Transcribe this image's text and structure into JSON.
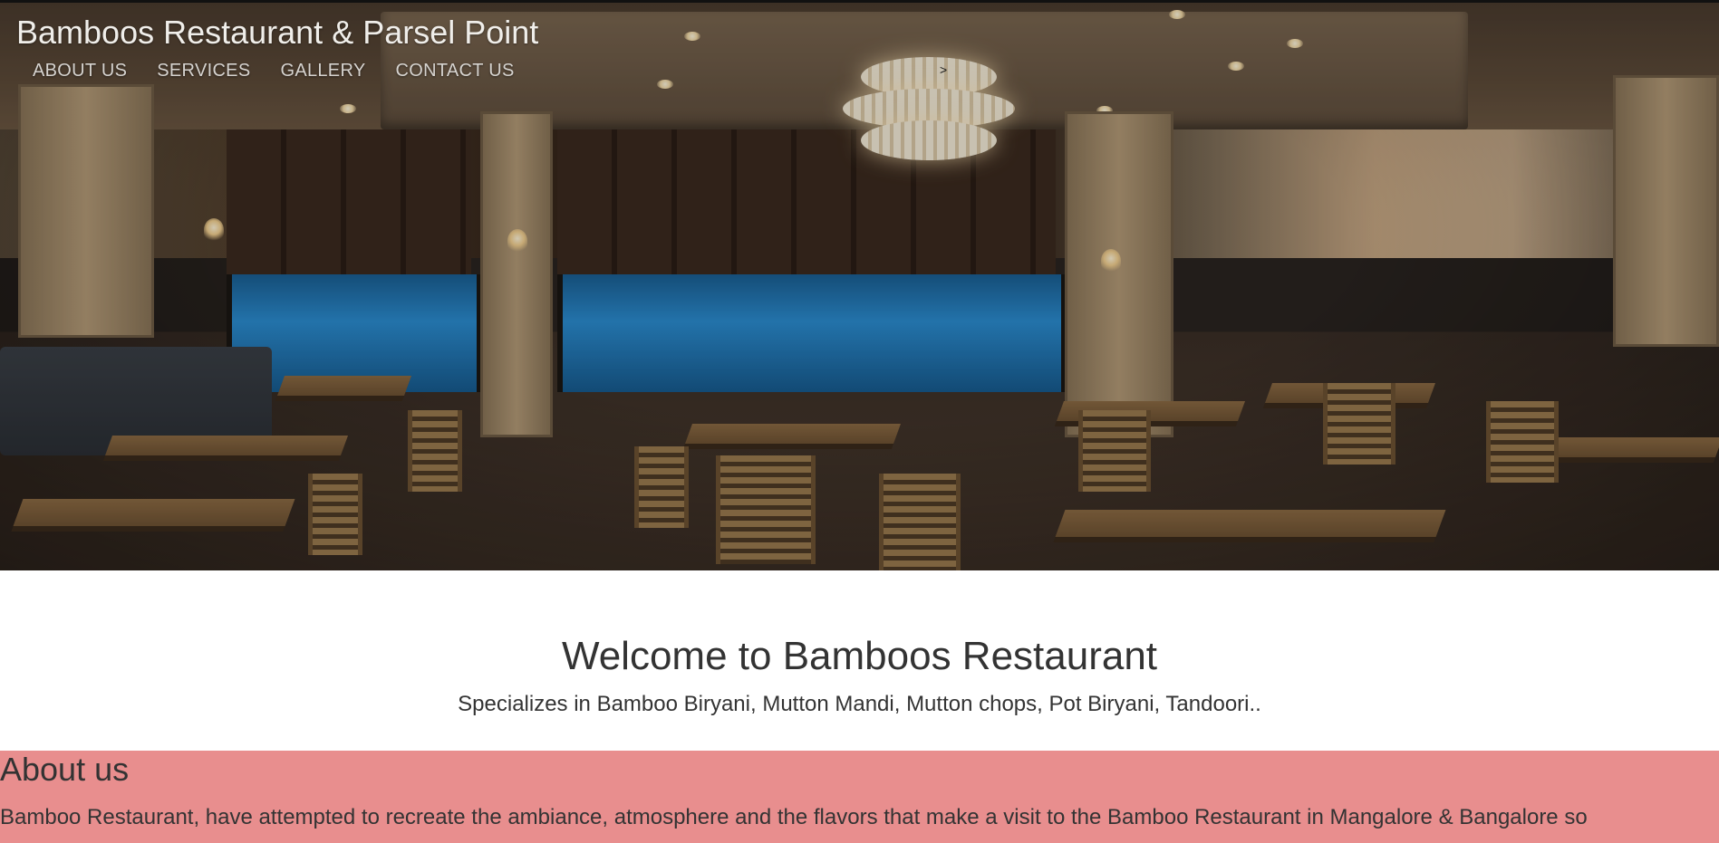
{
  "header": {
    "site_title": "Bamboos Restaurant & Parsel Point",
    "nav": [
      {
        "label": "ABOUT US"
      },
      {
        "label": "SERVICES"
      },
      {
        "label": "GALLERY"
      },
      {
        "label": "CONTACT US"
      }
    ],
    "carousel_next_glyph": ">"
  },
  "hero": {
    "image_subject": "restaurant-interior"
  },
  "welcome": {
    "heading": "Welcome to Bamboos Restaurant",
    "tagline": "Specializes in Bamboo Biryani, Mutton Mandi, Mutton chops, Pot Biryani, Tandoori.."
  },
  "about": {
    "heading": "About us",
    "text": "Bamboo Restaurant, have attempted to recreate the ambiance, atmosphere and the flavors that make a visit to the Bamboo Restaurant in Mangalore & Bangalore so",
    "background_color": "#e88e8e"
  }
}
